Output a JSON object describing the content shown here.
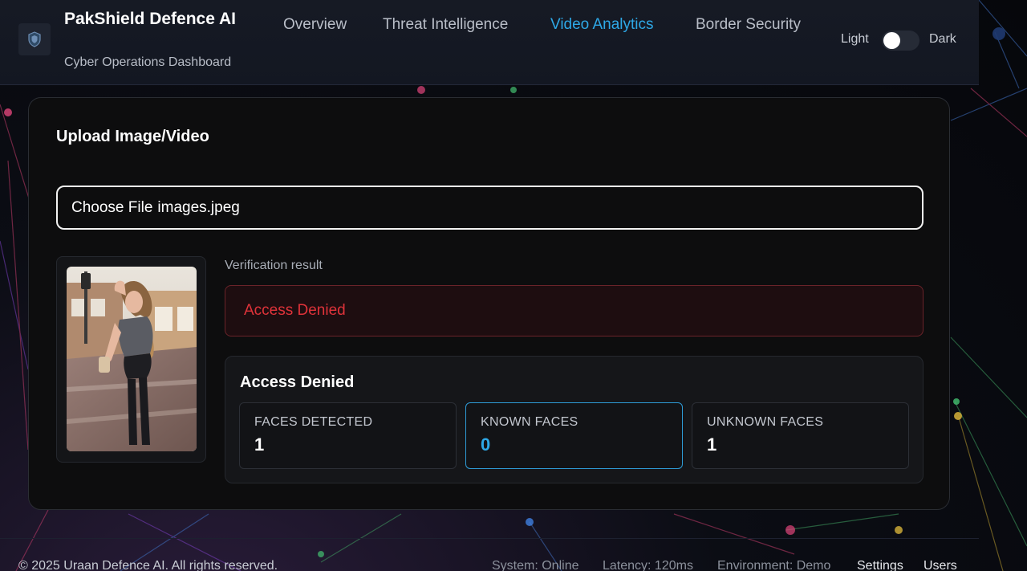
{
  "header": {
    "brand_title": "PakShield Defence AI",
    "brand_subtitle": "Cyber Operations Dashboard",
    "logo_icon": "shield-icon",
    "nav": [
      {
        "label": "Overview",
        "active": false
      },
      {
        "label": "Threat Intelligence",
        "active": false
      },
      {
        "label": "Video Analytics",
        "active": true
      },
      {
        "label": "Border Security",
        "active": false
      }
    ],
    "theme": {
      "light_label": "Light",
      "dark_label": "Dark",
      "dark_enabled": false
    }
  },
  "main": {
    "title": "Upload Image/Video",
    "file_input": {
      "button_label": "Choose File",
      "file_name": "images.jpeg"
    },
    "verification": {
      "label": "Verification result",
      "verdict": "Access Denied"
    },
    "summary": {
      "title": "Access Denied",
      "stats": [
        {
          "label": "FACES DETECTED",
          "value": "1",
          "highlight": false
        },
        {
          "label": "KNOWN FACES",
          "value": "0",
          "highlight": true
        },
        {
          "label": "UNKNOWN FACES",
          "value": "1",
          "highlight": false
        }
      ]
    }
  },
  "footer": {
    "copyright": "© 2025 Uraan Defence AI. All rights reserved.",
    "status_items": [
      "System: Online",
      "Latency: 120ms",
      "Environment: Demo"
    ],
    "links": [
      "Settings",
      "Users"
    ]
  },
  "colors": {
    "accent": "#2ea8e6",
    "danger": "#e0333a",
    "card_bg": "#0d0d0e",
    "header_bg": "#161a24"
  }
}
